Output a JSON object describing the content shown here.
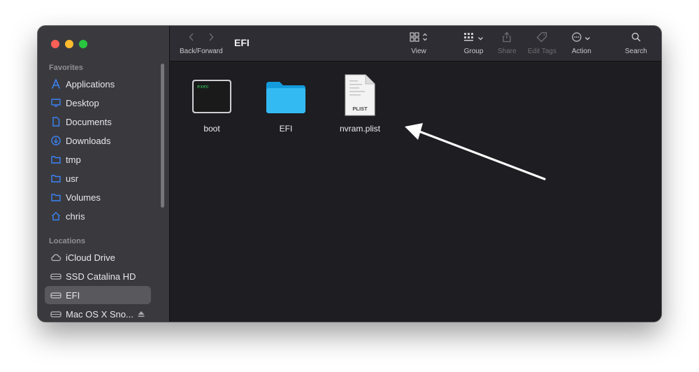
{
  "window": {
    "title": "EFI"
  },
  "toolbar": {
    "back_forward": "Back/Forward",
    "view": "View",
    "group": "Group",
    "share": "Share",
    "edit_tags": "Edit Tags",
    "action": "Action",
    "search": "Search"
  },
  "sidebar": {
    "favorites_label": "Favorites",
    "favorites": [
      {
        "label": "Applications",
        "icon": "applications-icon"
      },
      {
        "label": "Desktop",
        "icon": "desktop-icon"
      },
      {
        "label": "Documents",
        "icon": "document-icon"
      },
      {
        "label": "Downloads",
        "icon": "download-icon"
      },
      {
        "label": "tmp",
        "icon": "folder-icon"
      },
      {
        "label": "usr",
        "icon": "folder-icon"
      },
      {
        "label": "Volumes",
        "icon": "folder-icon"
      },
      {
        "label": "chris",
        "icon": "home-icon"
      }
    ],
    "locations_label": "Locations",
    "locations": [
      {
        "label": "iCloud Drive",
        "icon": "cloud-icon"
      },
      {
        "label": "SSD Catalina HD",
        "icon": "disk-icon"
      },
      {
        "label": "EFI",
        "icon": "disk-icon",
        "selected": true
      },
      {
        "label": "Mac OS X Sno...",
        "icon": "disk-icon",
        "ejectable": true
      }
    ]
  },
  "files": [
    {
      "name": "boot",
      "kind": "executable",
      "badge": "exec"
    },
    {
      "name": "EFI",
      "kind": "folder"
    },
    {
      "name": "nvram.plist",
      "kind": "plist",
      "badge": "PLIST"
    }
  ],
  "colors": {
    "accent": "#3b82f6",
    "folder": "#1fa9ec",
    "annotation_arrow": "#ffffff"
  }
}
